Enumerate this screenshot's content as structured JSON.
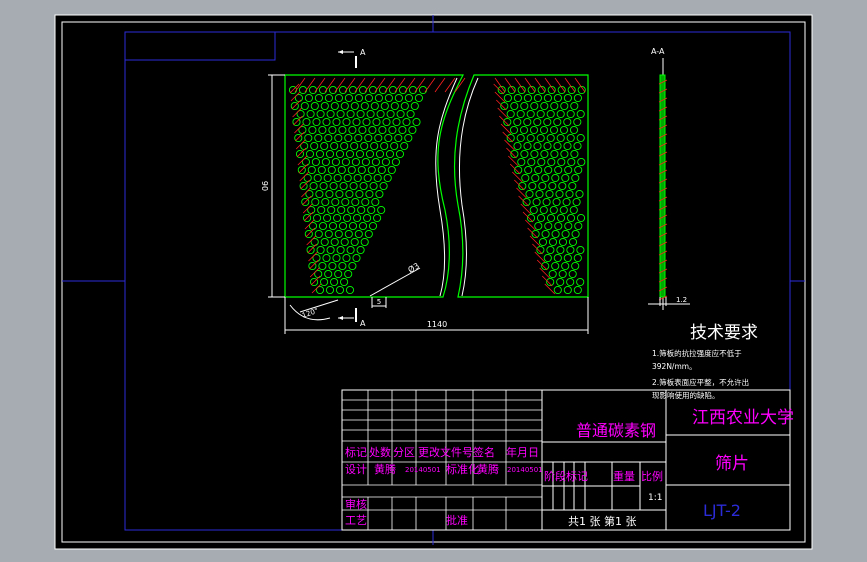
{
  "drawing": {
    "section_marks": [
      "A",
      "A"
    ],
    "section_view_label": "A-A",
    "dimensions": {
      "width": "1140",
      "height": "90",
      "hole_dia": "Ø3",
      "pitch": "5",
      "angle": "120°",
      "thickness": "1.2"
    }
  },
  "tech_req": {
    "title": "技术要求",
    "lines": [
      "1.筛板的抗拉强度应不低于",
      "392N/mm。",
      "2.筛板表面应平整，不允许出",
      "现影响使用的缺陷。"
    ]
  },
  "title_block": {
    "material": "普通碳素钢",
    "school": "江西农业大学",
    "part_name": "筛片",
    "drawing_no": "LJT-2",
    "scale": "1:1",
    "sheets": "共1 张 第1 张",
    "headers": [
      "标记",
      "处数",
      "分区",
      "更改文件号",
      "签名",
      "年月日"
    ],
    "design_row": [
      "设计",
      "黄腾",
      "20140501",
      "标准化",
      "黄腾",
      "20140501"
    ],
    "stage_headers": [
      "阶段标记",
      "重量",
      "比例"
    ],
    "bottom_labels": [
      "审核",
      "工艺",
      "批准"
    ]
  },
  "colors": {
    "background": "#000000",
    "frame": "#ffffff",
    "border_blue": "#2b2bd8",
    "outline_green": "#00ff00",
    "hatch_red": "#ff2020",
    "text_magenta": "#ff00ff",
    "text_white": "#ffffff"
  }
}
